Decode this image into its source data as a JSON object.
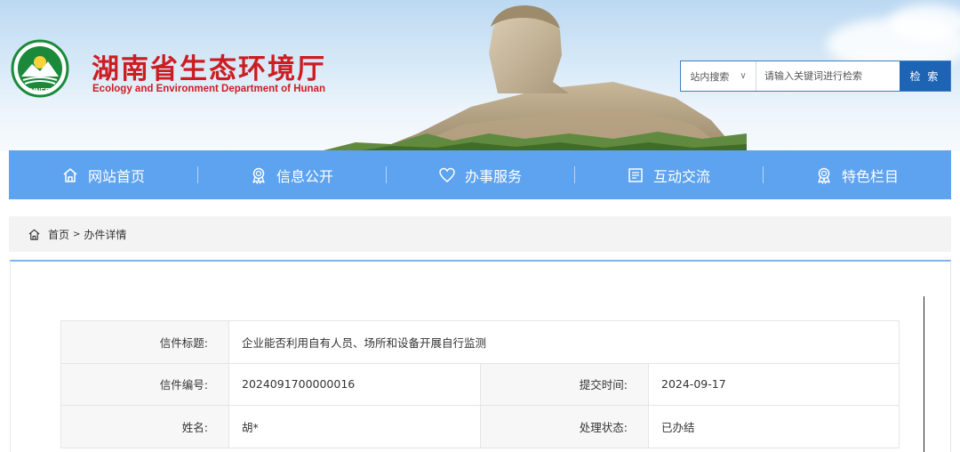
{
  "header": {
    "title_cn": "湖南省生态环境厅",
    "title_en": "Ecology and Environment Department of Hunan",
    "logo_text": "HNEE"
  },
  "search": {
    "scope_label": "站内搜索",
    "scope_caret": "∨",
    "placeholder": "请输入关键词进行检索",
    "button_label": "检 索"
  },
  "nav": {
    "items": [
      {
        "label": "网站首页",
        "icon": "home-icon"
      },
      {
        "label": "信息公开",
        "icon": "medal-icon"
      },
      {
        "label": "办事服务",
        "icon": "heart-icon"
      },
      {
        "label": "互动交流",
        "icon": "document-icon"
      },
      {
        "label": "特色栏目",
        "icon": "medal-icon"
      }
    ]
  },
  "breadcrumb": {
    "home": "首页",
    "separator": ">",
    "current": "办件详情"
  },
  "letter": {
    "title_label": "信件标题:",
    "title_value": "企业能否利用自有人员、场所和设备开展自行监测",
    "number_label": "信件编号:",
    "number_value": "2024091700000016",
    "submit_label": "提交时间:",
    "submit_value": "2024-09-17",
    "name_label": "姓名:",
    "name_value": "胡*",
    "status_label": "处理状态:",
    "status_value": "已办结"
  },
  "colors": {
    "brand_red": "#cc1d22",
    "nav_blue": "#5ea3ef",
    "search_button": "#1e64b4"
  }
}
